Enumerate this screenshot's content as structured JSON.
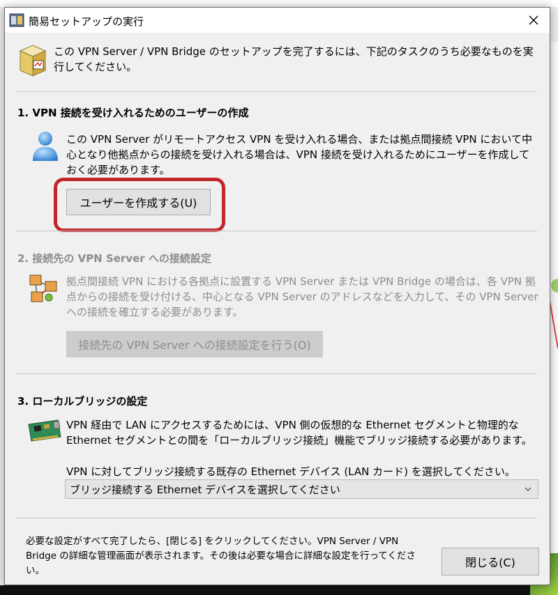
{
  "dialog": {
    "title": "簡易セットアップの実行",
    "intro": "この VPN Server / VPN Bridge のセットアップを完了するには、下記のタスクのうち必要なものを実行してください。"
  },
  "section1": {
    "heading": "1. VPN 接続を受け入れるためのユーザーの作成",
    "desc": "この VPN Server がリモートアクセス VPN を受け入れる場合、または拠点間接続 VPN において中心となり他拠点からの接続を受け入れる場合は、VPN 接続を受け入れるためにユーザーを作成しておく必要があります。",
    "button": "ユーザーを作成する(U)"
  },
  "section2": {
    "heading": "2. 接続先の VPN Server への接続設定",
    "desc": "拠点間接続 VPN における各拠点に設置する VPN Server または VPN Bridge の場合は、各 VPN 拠点からの接続を受け付ける、中心となる VPN Server のアドレスなどを入力して、その VPN Server への接続を確立する必要があります。",
    "button": "接続先の VPN Server への接続設定を行う(O)"
  },
  "section3": {
    "heading": "3. ローカルブリッジの設定",
    "desc": "VPN 経由で LAN にアクセスするためには、VPN 側の仮想的な Ethernet セグメントと物理的な Ethernet セグメントとの間を「ローカルブリッジ接続」機能でブリッジ接続する必要があります。",
    "prompt": "VPN に対してブリッジ接続する既存の Ethernet デバイス (LAN カード) を選択してください。",
    "select_value": "ブリッジ接続する Ethernet デバイスを選択してください"
  },
  "footer": {
    "note": "必要な設定がすべて完了したら、[閉じる] をクリックしてください。VPN Server / VPN Bridge の詳細な管理画面が表示されます。その後は必要な場合に詳細な設定を行ってください。",
    "close_button": "閉じる(C)"
  },
  "colors": {
    "highlight": "#c1272d",
    "disabled_text": "#8c8c8c"
  }
}
